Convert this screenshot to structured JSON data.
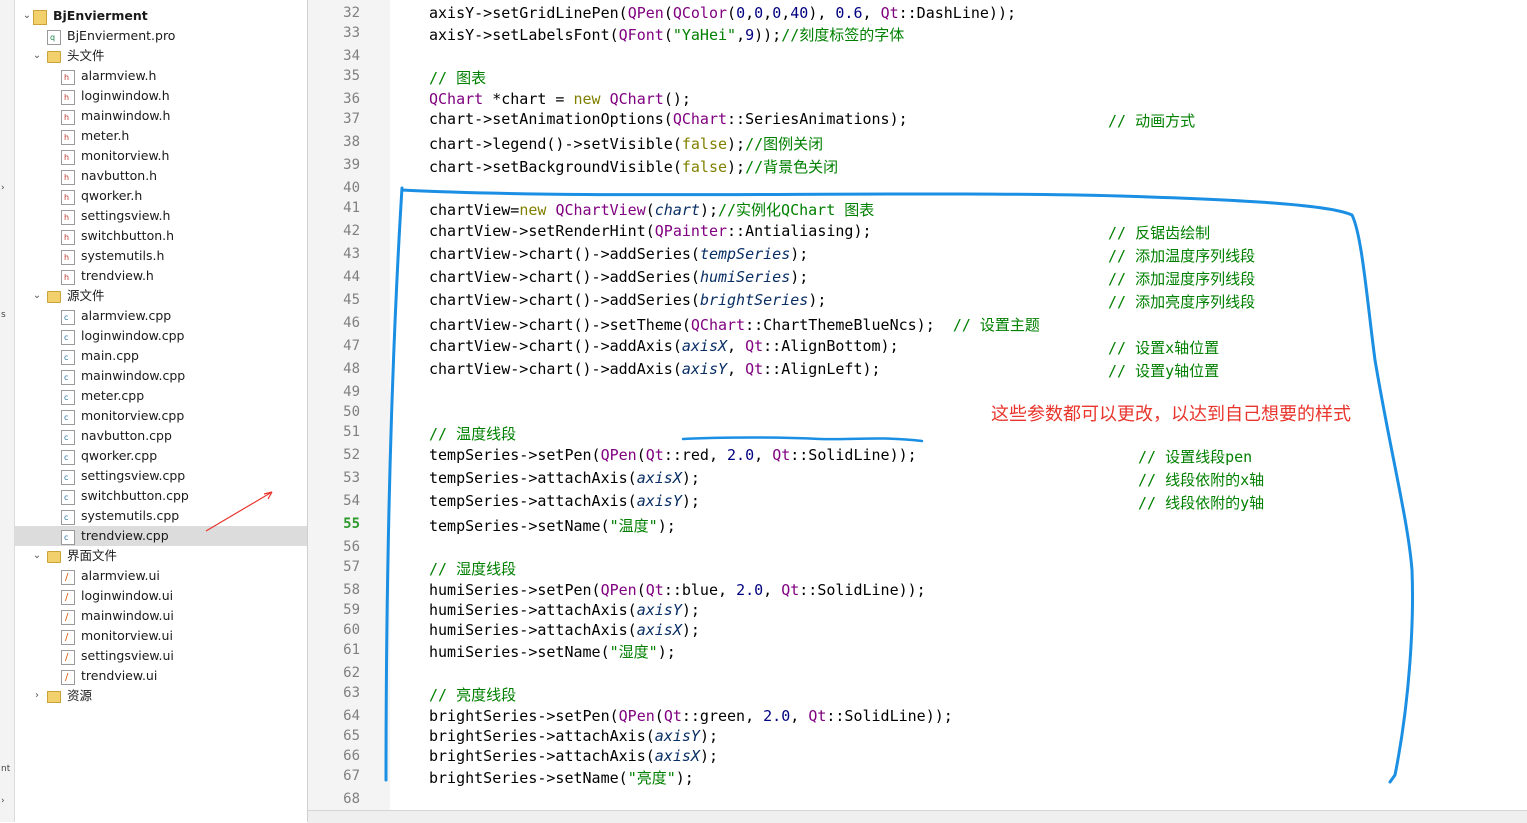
{
  "left_strip": {
    "labels": [
      "s",
      "nt"
    ]
  },
  "tree": {
    "rows": [
      {
        "label": "BjEnvierment",
        "level": 0,
        "icon": "project-icon",
        "chevron": "down",
        "bold": true
      },
      {
        "label": "BjEnvierment.pro",
        "level": 1,
        "icon": "pro-file-icon"
      },
      {
        "label": "头文件",
        "level": 1,
        "icon": "folder-icon",
        "chevron": "down"
      },
      {
        "label": "alarmview.h",
        "level": 2,
        "icon": "header-file-icon"
      },
      {
        "label": "loginwindow.h",
        "level": 2,
        "icon": "header-file-icon"
      },
      {
        "label": "mainwindow.h",
        "level": 2,
        "icon": "header-file-icon"
      },
      {
        "label": "meter.h",
        "level": 2,
        "icon": "header-file-icon"
      },
      {
        "label": "monitorview.h",
        "level": 2,
        "icon": "header-file-icon"
      },
      {
        "label": "navbutton.h",
        "level": 2,
        "icon": "header-file-icon"
      },
      {
        "label": "qworker.h",
        "level": 2,
        "icon": "header-file-icon"
      },
      {
        "label": "settingsview.h",
        "level": 2,
        "icon": "header-file-icon"
      },
      {
        "label": "switchbutton.h",
        "level": 2,
        "icon": "header-file-icon"
      },
      {
        "label": "systemutils.h",
        "level": 2,
        "icon": "header-file-icon"
      },
      {
        "label": "trendview.h",
        "level": 2,
        "icon": "header-file-icon"
      },
      {
        "label": "源文件",
        "level": 1,
        "icon": "folder-icon",
        "chevron": "down"
      },
      {
        "label": "alarmview.cpp",
        "level": 2,
        "icon": "cpp-file-icon"
      },
      {
        "label": "loginwindow.cpp",
        "level": 2,
        "icon": "cpp-file-icon"
      },
      {
        "label": "main.cpp",
        "level": 2,
        "icon": "cpp-file-icon"
      },
      {
        "label": "mainwindow.cpp",
        "level": 2,
        "icon": "cpp-file-icon"
      },
      {
        "label": "meter.cpp",
        "level": 2,
        "icon": "cpp-file-icon"
      },
      {
        "label": "monitorview.cpp",
        "level": 2,
        "icon": "cpp-file-icon"
      },
      {
        "label": "navbutton.cpp",
        "level": 2,
        "icon": "cpp-file-icon"
      },
      {
        "label": "qworker.cpp",
        "level": 2,
        "icon": "cpp-file-icon"
      },
      {
        "label": "settingsview.cpp",
        "level": 2,
        "icon": "cpp-file-icon"
      },
      {
        "label": "switchbutton.cpp",
        "level": 2,
        "icon": "cpp-file-icon"
      },
      {
        "label": "systemutils.cpp",
        "level": 2,
        "icon": "cpp-file-icon"
      },
      {
        "label": "trendview.cpp",
        "level": 2,
        "icon": "cpp-file-icon",
        "selected": true
      },
      {
        "label": "界面文件",
        "level": 1,
        "icon": "folder-icon",
        "chevron": "down"
      },
      {
        "label": "alarmview.ui",
        "level": 2,
        "icon": "ui-file-icon"
      },
      {
        "label": "loginwindow.ui",
        "level": 2,
        "icon": "ui-file-icon"
      },
      {
        "label": "mainwindow.ui",
        "level": 2,
        "icon": "ui-file-icon"
      },
      {
        "label": "monitorview.ui",
        "level": 2,
        "icon": "ui-file-icon"
      },
      {
        "label": "settingsview.ui",
        "level": 2,
        "icon": "ui-file-icon"
      },
      {
        "label": "trendview.ui",
        "level": 2,
        "icon": "ui-file-icon"
      },
      {
        "label": "资源",
        "level": 1,
        "icon": "resource-folder-icon",
        "chevron": "right"
      }
    ]
  },
  "editor": {
    "current_line": 55,
    "line_numbers": [
      32,
      33,
      34,
      35,
      36,
      37,
      38,
      39,
      40,
      41,
      42,
      43,
      44,
      45,
      46,
      47,
      48,
      49,
      50,
      51,
      52,
      53,
      54,
      55,
      56,
      57,
      58,
      59,
      60,
      61,
      62,
      63,
      64,
      65,
      66,
      67,
      68
    ],
    "lines": [
      {
        "n": 32,
        "code": "axisY->setGridLinePen(QPen(QColor(0,0,0,40), 0.6, Qt::DashLine));",
        "comment": ""
      },
      {
        "n": 33,
        "code": "axisY->setLabelsFont(QFont(\"YaHei\",9));//刻度标签的字体",
        "comment": ""
      },
      {
        "n": 34,
        "code": "",
        "comment": ""
      },
      {
        "n": 35,
        "code": "// 图表",
        "comment": ""
      },
      {
        "n": 36,
        "code": "QChart *chart = new QChart();",
        "comment": ""
      },
      {
        "n": 37,
        "code": "chart->setAnimationOptions(QChart::SeriesAnimations);",
        "comment": "// 动画方式"
      },
      {
        "n": 38,
        "code": "chart->legend()->setVisible(false);//图例关闭",
        "comment": ""
      },
      {
        "n": 39,
        "code": "chart->setBackgroundVisible(false);//背景色关闭",
        "comment": ""
      },
      {
        "n": 40,
        "code": "",
        "comment": ""
      },
      {
        "n": 41,
        "code": "chartView=new QChartView(chart);//实例化QChart 图表",
        "comment": ""
      },
      {
        "n": 42,
        "code": "chartView->setRenderHint(QPainter::Antialiasing);",
        "comment": "// 反锯齿绘制"
      },
      {
        "n": 43,
        "code": "chartView->chart()->addSeries(tempSeries);",
        "comment": "// 添加温度序列线段"
      },
      {
        "n": 44,
        "code": "chartView->chart()->addSeries(humiSeries);",
        "comment": "// 添加湿度序列线段"
      },
      {
        "n": 45,
        "code": "chartView->chart()->addSeries(brightSeries);",
        "comment": "// 添加亮度序列线段"
      },
      {
        "n": 46,
        "code": "chartView->chart()->setTheme(QChart::ChartThemeBlueNcs);  // 设置主题",
        "comment": ""
      },
      {
        "n": 47,
        "code": "chartView->chart()->addAxis(axisX, Qt::AlignBottom);",
        "comment": "// 设置x轴位置"
      },
      {
        "n": 48,
        "code": "chartView->chart()->addAxis(axisY, Qt::AlignLeft);",
        "comment": "// 设置y轴位置"
      },
      {
        "n": 49,
        "code": "",
        "comment": ""
      },
      {
        "n": 50,
        "code": "",
        "comment": ""
      },
      {
        "n": 51,
        "code": "// 温度线段",
        "comment": ""
      },
      {
        "n": 52,
        "code": "tempSeries->setPen(QPen(Qt::red, 2.0, Qt::SolidLine));",
        "comment": "// 设置线段pen"
      },
      {
        "n": 53,
        "code": "tempSeries->attachAxis(axisX);",
        "comment": "// 线段依附的x轴"
      },
      {
        "n": 54,
        "code": "tempSeries->attachAxis(axisY);",
        "comment": "// 线段依附的y轴"
      },
      {
        "n": 55,
        "code": "tempSeries->setName(\"温度\");",
        "comment": ""
      },
      {
        "n": 56,
        "code": "",
        "comment": ""
      },
      {
        "n": 57,
        "code": "// 湿度线段",
        "comment": ""
      },
      {
        "n": 58,
        "code": "humiSeries->setPen(QPen(Qt::blue, 2.0, Qt::SolidLine));",
        "comment": ""
      },
      {
        "n": 59,
        "code": "humiSeries->attachAxis(axisY);",
        "comment": ""
      },
      {
        "n": 60,
        "code": "humiSeries->attachAxis(axisX);",
        "comment": ""
      },
      {
        "n": 61,
        "code": "humiSeries->setName(\"湿度\");",
        "comment": ""
      },
      {
        "n": 62,
        "code": "",
        "comment": ""
      },
      {
        "n": 63,
        "code": "// 亮度线段",
        "comment": ""
      },
      {
        "n": 64,
        "code": "brightSeries->setPen(QPen(Qt::green, 2.0, Qt::SolidLine));",
        "comment": ""
      },
      {
        "n": 65,
        "code": "brightSeries->attachAxis(axisY);",
        "comment": ""
      },
      {
        "n": 66,
        "code": "brightSeries->attachAxis(axisX);",
        "comment": ""
      },
      {
        "n": 67,
        "code": "brightSeries->setName(\"亮度\");",
        "comment": ""
      },
      {
        "n": 68,
        "code": "",
        "comment": ""
      }
    ]
  },
  "annotation": {
    "text": "这些参数都可以更改，以达到自己想要的样式",
    "color": "#e8362d"
  },
  "colors": {
    "markup_blue": "#1a8fe3",
    "arrow_red": "#e8362d",
    "comment_green": "#008000",
    "current_line_green": "#2e9a2e"
  }
}
